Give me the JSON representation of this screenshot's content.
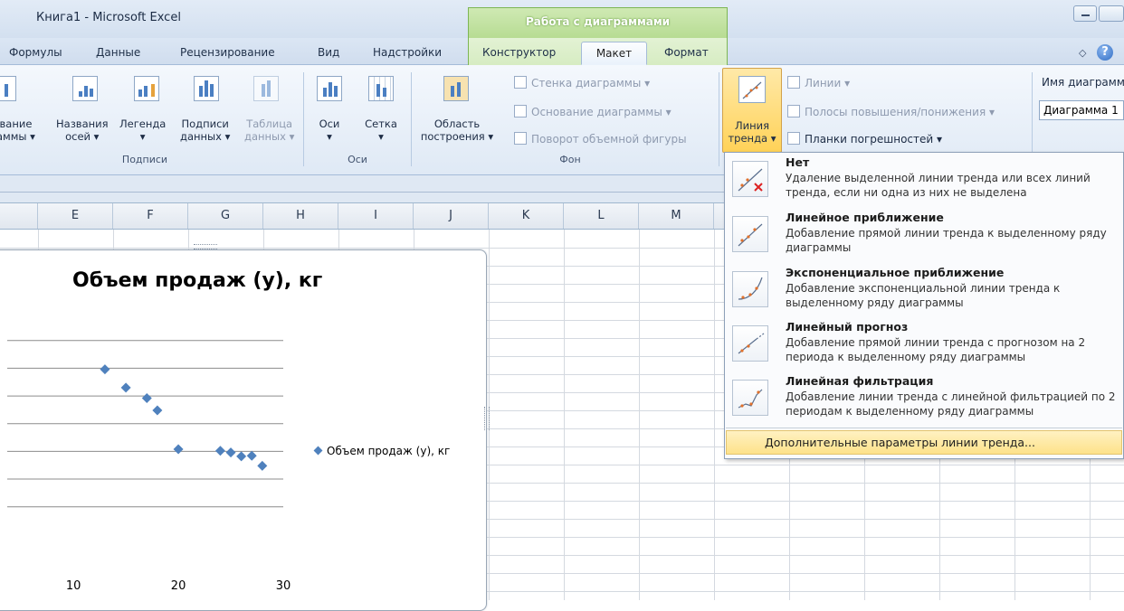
{
  "window": {
    "title": "Книга1  -  Microsoft Excel",
    "context_header": "Работа с диаграммами"
  },
  "tabs": [
    {
      "label": "Формулы"
    },
    {
      "label": "Данные"
    },
    {
      "label": "Рецензирование"
    },
    {
      "label": "Вид"
    },
    {
      "label": "Надстройки"
    },
    {
      "label": "Конструктор"
    },
    {
      "label": "Макет",
      "active": true
    },
    {
      "label": "Формат"
    }
  ],
  "ribbon": {
    "labels_group": {
      "label": "Подписи",
      "chart_title": [
        "вание",
        "аммы ▾"
      ],
      "axis_titles": [
        "Названия",
        "осей ▾"
      ],
      "legend": [
        "Легенда",
        "▾"
      ],
      "data_labels": [
        "Подписи",
        "данных ▾"
      ],
      "data_table": [
        "Таблица",
        "данных ▾"
      ]
    },
    "axes_group": {
      "label": "Оси",
      "axes": [
        "Оси",
        "▾"
      ],
      "gridlines": [
        "Сетка",
        "▾"
      ]
    },
    "background_group": {
      "label": "Фон",
      "plot_area": [
        "Область",
        "построения ▾"
      ],
      "chart_wall": "Стенка диаграммы ▾",
      "chart_floor": "Основание диаграммы ▾",
      "rotation_3d": "Поворот объемной фигуры"
    },
    "analysis_group": {
      "trendline": [
        "Линия",
        "тренда ▾"
      ],
      "lines": "Линии ▾",
      "updown_bars": "Полосы повышения/понижения ▾",
      "error_bars": "Планки погрешностей ▾"
    },
    "properties_group": {
      "chart_name_label": "Имя диаграммы",
      "chart_name_value": "Диаграмма 1"
    }
  },
  "columns": [
    "E",
    "F",
    "G",
    "H",
    "I",
    "J",
    "K",
    "L",
    "M"
  ],
  "chart_data": {
    "type": "scatter",
    "title": "Объем продаж (у), кг",
    "series": [
      {
        "name": "Объем продаж (у), кг",
        "color": "#4f81bd",
        "x": [
          13,
          15,
          17,
          18,
          20,
          24,
          25,
          26,
          27,
          28
        ],
        "y": [
          64.8,
          61.5,
          59.6,
          57.4,
          50.4,
          50.1,
          49.8,
          49.1,
          49.2,
          47.4
        ]
      }
    ],
    "xticks": [
      10,
      20,
      30
    ],
    "xlim": [
      3,
      30
    ],
    "ylim": [
      30,
      76
    ],
    "gridlines": [
      40,
      45,
      50,
      55,
      60,
      65,
      70
    ],
    "legend_position": "right"
  },
  "trend_menu": {
    "items": [
      {
        "title": "Нет",
        "desc": "Удаление выделенной линии тренда или всех линий тренда, если ни одна из них не выделена",
        "icon": "trendline-none-icon"
      },
      {
        "title": "Линейное приближение",
        "desc": "Добавление прямой линии тренда к выделенному ряду диаграммы",
        "icon": "trendline-linear-icon"
      },
      {
        "title": "Экспоненциальное приближение",
        "desc": "Добавление экспоненциальной линии тренда к выделенному ряду диаграммы",
        "icon": "trendline-exponential-icon"
      },
      {
        "title": "Линейный прогноз",
        "desc": "Добавление прямой линии тренда с прогнозом на 2 периода к выделенному ряду диаграммы",
        "icon": "trendline-forecast-icon"
      },
      {
        "title": "Линейная фильтрация",
        "desc": "Добавление линии тренда с линейной фильтрацией по 2 периодам к выделенному ряду диаграммы",
        "icon": "trendline-moving-average-icon"
      }
    ],
    "more_options": "Дополнительные параметры линии тренда..."
  }
}
